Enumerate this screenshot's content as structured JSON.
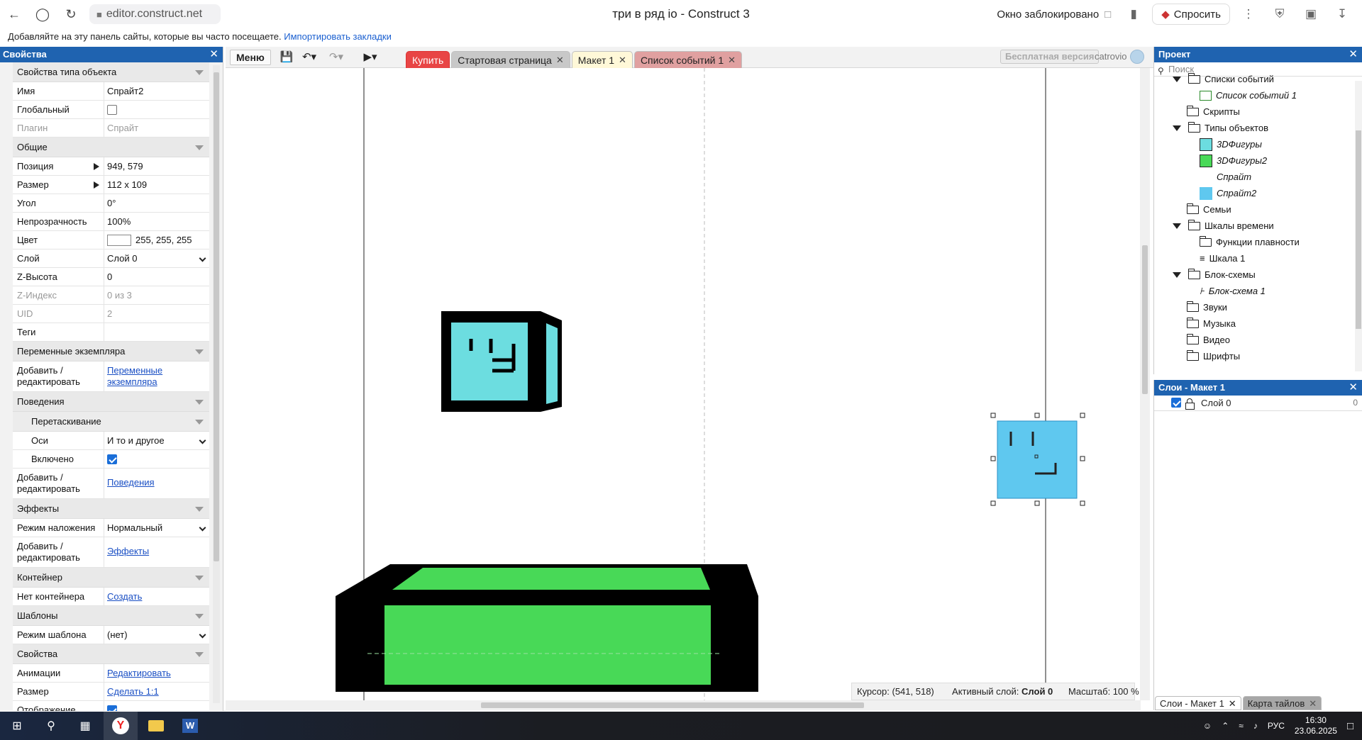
{
  "browser": {
    "url": "editor.construct.net",
    "tab_title": "три в ряд io - Construct 3",
    "popup_blocked": "Окно заблокировано",
    "ask_label": "Спросить",
    "bookmarks_hint": "Добавляйте на эту панель сайты, которые вы часто посещаете.",
    "import_bookmarks": "Импортировать закладки"
  },
  "props_panel": {
    "title": "Свойства",
    "sections": {
      "object_type": "Свойства типа объекта",
      "common": "Общие",
      "instance_vars": "Переменные экземпляра",
      "behaviors": "Поведения",
      "drag": "Перетаскивание",
      "effects": "Эффекты",
      "container": "Контейнер",
      "templates": "Шаблоны",
      "properties": "Свойства"
    },
    "rows": {
      "name_label": "Имя",
      "name_value": "Спрайт2",
      "global_label": "Глобальный",
      "plugin_label": "Плагин",
      "plugin_value": "Спрайт",
      "position_label": "Позиция",
      "position_value": "949,  579",
      "size_label": "Размер",
      "size_value": "112 x 109",
      "angle_label": "Угол",
      "angle_value": "0°",
      "opacity_label": "Непрозрачность",
      "opacity_value": "100%",
      "color_label": "Цвет",
      "color_value": "255, 255, 255",
      "layer_label": "Слой",
      "layer_value": "Слой 0",
      "zelev_label": "Z-Высота",
      "zelev_value": "0",
      "zindex_label": "Z-Индекс",
      "zindex_value": "0 из 3",
      "uid_label": "UID",
      "uid_value": "2",
      "tags_label": "Теги",
      "add_edit_label": "Добавить / редактировать",
      "instance_vars_link": "Переменные экземпляра",
      "axes_label": "Оси",
      "axes_value": "И то и другое",
      "enabled_label": "Включено",
      "behaviors_link": "Поведения",
      "blend_label": "Режим наложения",
      "blend_value": "Нормальный",
      "effects_link": "Эффекты",
      "no_container_label": "Нет контейнера",
      "create_link": "Создать",
      "template_mode_label": "Режим шаблона",
      "template_mode_value": "(нет)",
      "animations_label": "Анимации",
      "animations_link": "Редактировать",
      "size2_label": "Размер",
      "size2_link": "Сделать 1:1",
      "display_label": "Отображение"
    }
  },
  "toolbar": {
    "menu": "Меню",
    "tabs": {
      "buy": "Купить",
      "start": "Стартовая страница",
      "layout": "Макет 1",
      "events": "Список событий 1"
    },
    "free_version": "Бесплатная версия",
    "user": "catrovio"
  },
  "status": {
    "cursor": "Курсор: (541, 518)",
    "active_layer_label": "Активный слой:",
    "active_layer_value": "Слой 0",
    "zoom": "Масштаб: 100 %"
  },
  "project": {
    "title": "Проект",
    "search_placeholder": "Поиск",
    "items": {
      "event_sheets": "Списки событий",
      "event_sheet_1": "Список событий 1",
      "scripts": "Скрипты",
      "object_types": "Типы объектов",
      "shape3d": "3DФигуры",
      "shape3d2": "3DФигуры2",
      "sprite": "Спрайт",
      "sprite2": "Спрайт2",
      "families": "Семьи",
      "timelines": "Шкалы времени",
      "easing": "Функции плавности",
      "timeline1": "Шкала 1",
      "flowcharts": "Блок-схемы",
      "flowchart1": "Блок-схема 1",
      "sounds": "Звуки",
      "music": "Музыка",
      "video": "Видео",
      "fonts": "Шрифты"
    }
  },
  "layers": {
    "title": "Слои - Макет 1",
    "layer0": "Слой 0",
    "layer0_count": "0",
    "bottom_tab_layers": "Слои - Макет 1",
    "bottom_tab_tilemap": "Карта тайлов"
  },
  "taskbar": {
    "lang": "РУС",
    "time": "16:30",
    "date": "23.06.2025"
  },
  "colors": {
    "panel_header": "#1f63b0",
    "cube_face": "#6cdde0",
    "selected_sprite": "#5fc8ef",
    "green_face": "#48d957",
    "buy_tab": "#e84545"
  }
}
